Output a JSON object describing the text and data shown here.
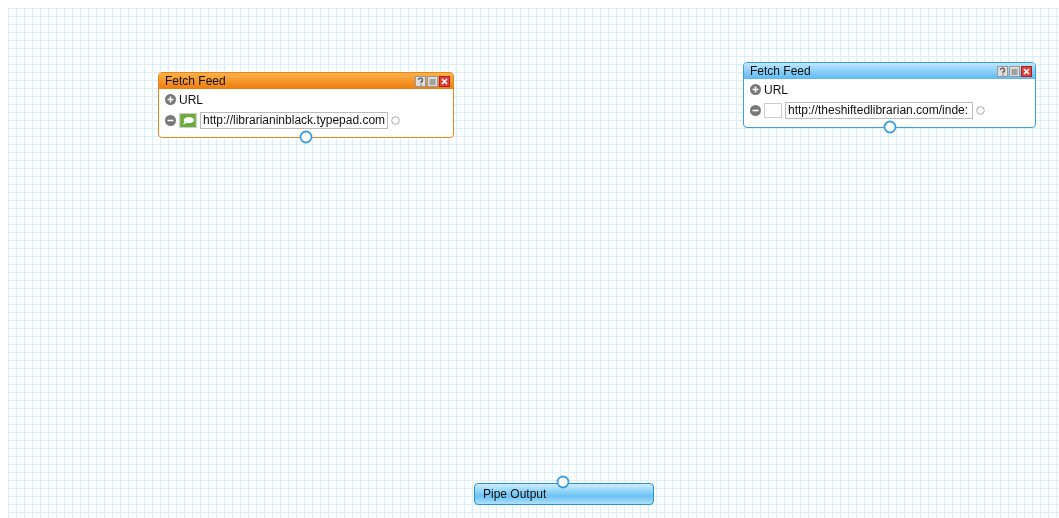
{
  "modules": [
    {
      "kind": "fetch",
      "title": "Fetch Feed",
      "selected": true,
      "field_label": "URL",
      "urls": [
        {
          "value": "http://librarianinblack.typepad.com",
          "favicon": true
        }
      ]
    },
    {
      "kind": "fetch",
      "title": "Fetch Feed",
      "selected": false,
      "field_label": "URL",
      "urls": [
        {
          "value": "http://theshiftedlibrarian.com/inde:",
          "favicon": false
        }
      ]
    },
    {
      "kind": "output",
      "title": "Pipe Output",
      "selected": false
    }
  ]
}
